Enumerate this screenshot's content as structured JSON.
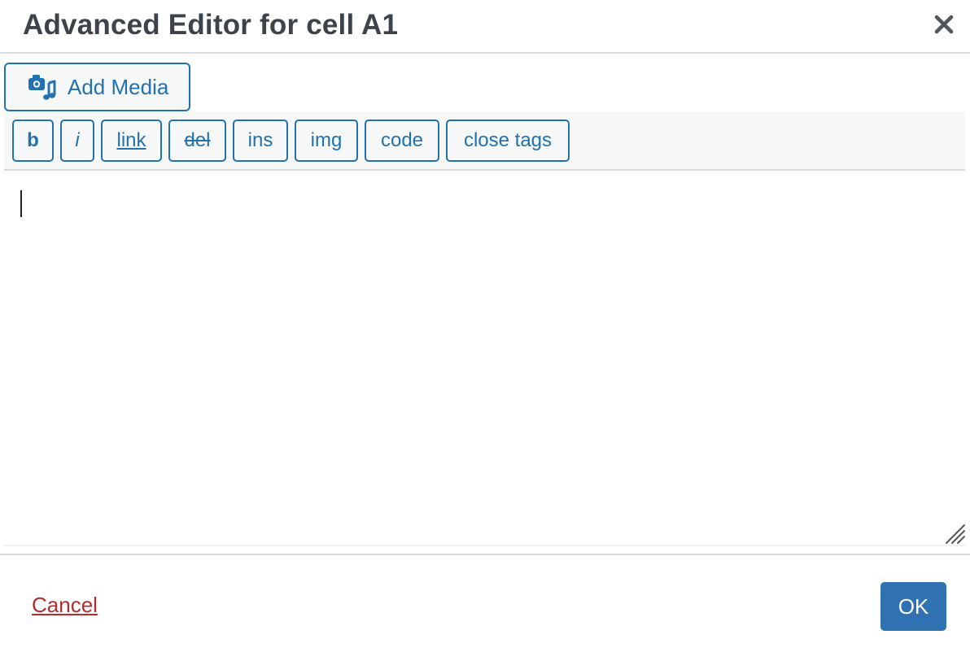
{
  "dialog": {
    "title": "Advanced Editor for cell A1",
    "close_icon": "close-icon"
  },
  "media": {
    "add_media_label": "Add Media",
    "icon": "add-media-icon"
  },
  "quicktags": [
    {
      "id": "b",
      "label": "b"
    },
    {
      "id": "i",
      "label": "i"
    },
    {
      "id": "link",
      "label": "link"
    },
    {
      "id": "del",
      "label": "del"
    },
    {
      "id": "ins",
      "label": "ins"
    },
    {
      "id": "img",
      "label": "img"
    },
    {
      "id": "code",
      "label": "code"
    },
    {
      "id": "close",
      "label": "close tags"
    }
  ],
  "editor": {
    "value": ""
  },
  "footer": {
    "cancel_label": "Cancel",
    "ok_label": "OK"
  },
  "colors": {
    "accent": "#2271b1",
    "ok_button": "#2f71b1",
    "cancel_link": "#b32d2e",
    "title_text": "#3c434a",
    "toolbar_bg": "#f6f7f7"
  }
}
